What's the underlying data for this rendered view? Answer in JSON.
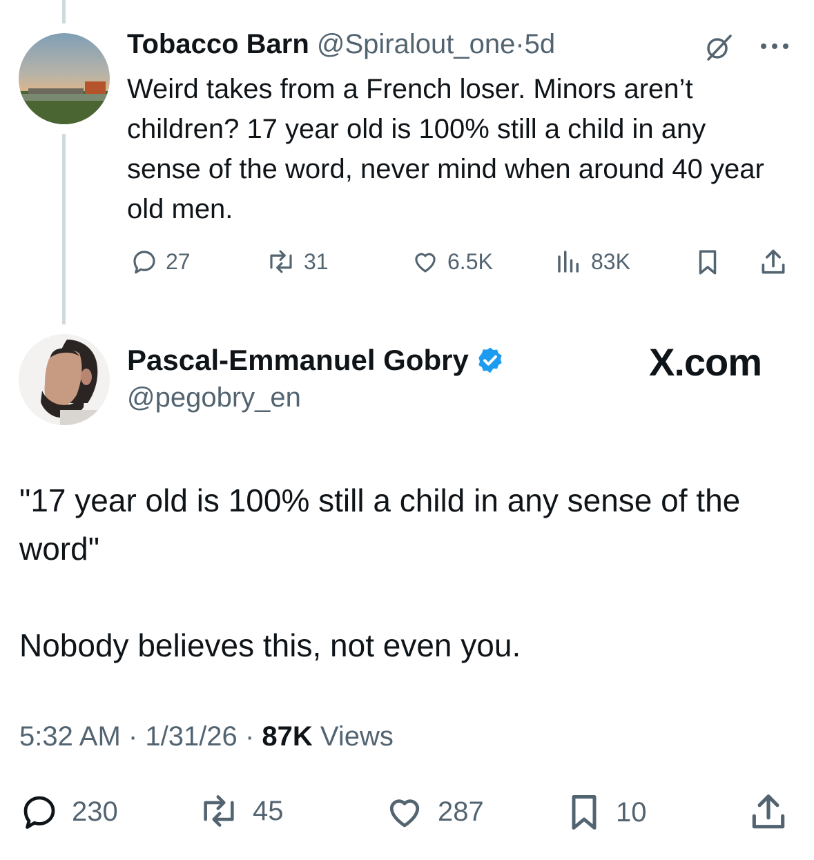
{
  "reply_tweet": {
    "display_name": "Tobacco Barn",
    "handle": "@Spiralout_one",
    "separator": "·",
    "age": "5d",
    "text": "Weird takes from a French loser. Minors aren’t children? 17 year old is 100% still a child in any sense of the word, never mind when around 40 year old men.",
    "stats": {
      "replies": "27",
      "reposts": "31",
      "likes": "6.5K",
      "views": "83K"
    }
  },
  "main_tweet": {
    "display_name": "Pascal-Emmanuel Gobry",
    "handle": "@pegobry_en",
    "verified": true,
    "brand": "X.com",
    "paragraph1": "\"17 year old is 100% still a child in any sense of the word\"",
    "paragraph2": "Nobody believes this, not even you.",
    "time": "5:32 AM",
    "dot": "·",
    "date": "1/31/26",
    "views_count": "87K",
    "views_label": "Views",
    "stats": {
      "replies": "230",
      "reposts": "45",
      "likes": "287",
      "bookmarks": "10"
    }
  },
  "colors": {
    "text": "#0f1419",
    "muted": "#536471",
    "verified": "#1d9bf0",
    "thread_line": "#cfd9de"
  }
}
